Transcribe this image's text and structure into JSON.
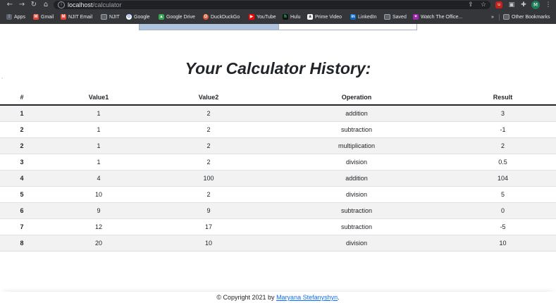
{
  "browser": {
    "url_host": "localhost",
    "url_path": "/calculator",
    "bookmarks": [
      {
        "label": "Apps",
        "icon": "apps-grid-icon",
        "color": "#8ab4f8"
      },
      {
        "label": "Gmail",
        "icon": "gmail-icon",
        "color": "#ea4335"
      },
      {
        "label": "NJIT Email",
        "icon": "gmail-icon",
        "color": "#ea4335"
      },
      {
        "label": "NJIT",
        "icon": "folder-icon",
        "color": "#9aa0a6"
      },
      {
        "label": "Google",
        "icon": "google-icon",
        "color": "#4285f4"
      },
      {
        "label": "Google Drive",
        "icon": "google-drive-icon",
        "color": "#34a853"
      },
      {
        "label": "DuckDuckGo",
        "icon": "duckduckgo-icon",
        "color": "#de5833"
      },
      {
        "label": "YouTube",
        "icon": "youtube-icon",
        "color": "#ff0000"
      },
      {
        "label": "Hulu",
        "icon": "hulu-icon",
        "color": "#1ce783"
      },
      {
        "label": "Prime Video",
        "icon": "amazon-icon",
        "color": "#ffffff"
      },
      {
        "label": "LinkedIn",
        "icon": "linkedin-icon",
        "color": "#0a66c2"
      },
      {
        "label": "Saved",
        "icon": "folder-icon",
        "color": "#9aa0a6"
      },
      {
        "label": "Watch The Office...",
        "icon": "tv-icon",
        "color": "#9c27b0"
      }
    ],
    "more_bookmarks": "»",
    "other_bookmarks": "Other Bookmarks",
    "profile_initial": "M"
  },
  "page": {
    "title": "Your Calculator History:",
    "stray_mark": "`"
  },
  "table": {
    "headers": [
      "#",
      "Value1",
      "Value2",
      "Operation",
      "Result"
    ],
    "rows": [
      [
        "1",
        "1",
        "2",
        "addition",
        "3"
      ],
      [
        "2",
        "1",
        "2",
        "subtraction",
        "-1"
      ],
      [
        "2",
        "1",
        "2",
        "multiplication",
        "2"
      ],
      [
        "3",
        "1",
        "2",
        "division",
        "0.5"
      ],
      [
        "4",
        "4",
        "100",
        "addition",
        "104"
      ],
      [
        "5",
        "10",
        "2",
        "division",
        "5"
      ],
      [
        "6",
        "9",
        "9",
        "subtraction",
        "0"
      ],
      [
        "7",
        "12",
        "17",
        "subtraction",
        "-5"
      ],
      [
        "8",
        "20",
        "10",
        "division",
        "10"
      ]
    ]
  },
  "footer": {
    "prefix": "© Copyright 2021 by ",
    "author": "Maryana Stefanyshyn",
    "suffix": "."
  }
}
